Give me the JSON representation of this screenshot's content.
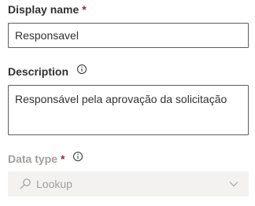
{
  "display_name": {
    "label": "Display name",
    "required_mark": "*",
    "value": "Responsavel"
  },
  "description": {
    "label": "Description",
    "info_icon": "info-icon",
    "value": "Responsável pela aprovação da solicitação"
  },
  "data_type": {
    "label": "Data type",
    "required_mark": "*",
    "info_icon": "info-icon",
    "search_icon": "search-icon",
    "value": "Lookup",
    "chevron_icon": "chevron-down-icon",
    "disabled": true
  },
  "colors": {
    "text": "#323130",
    "required": "#a4262c",
    "disabled_text": "#a19f9d",
    "disabled_bg": "#f3f2f1",
    "border": "#605e5c"
  }
}
